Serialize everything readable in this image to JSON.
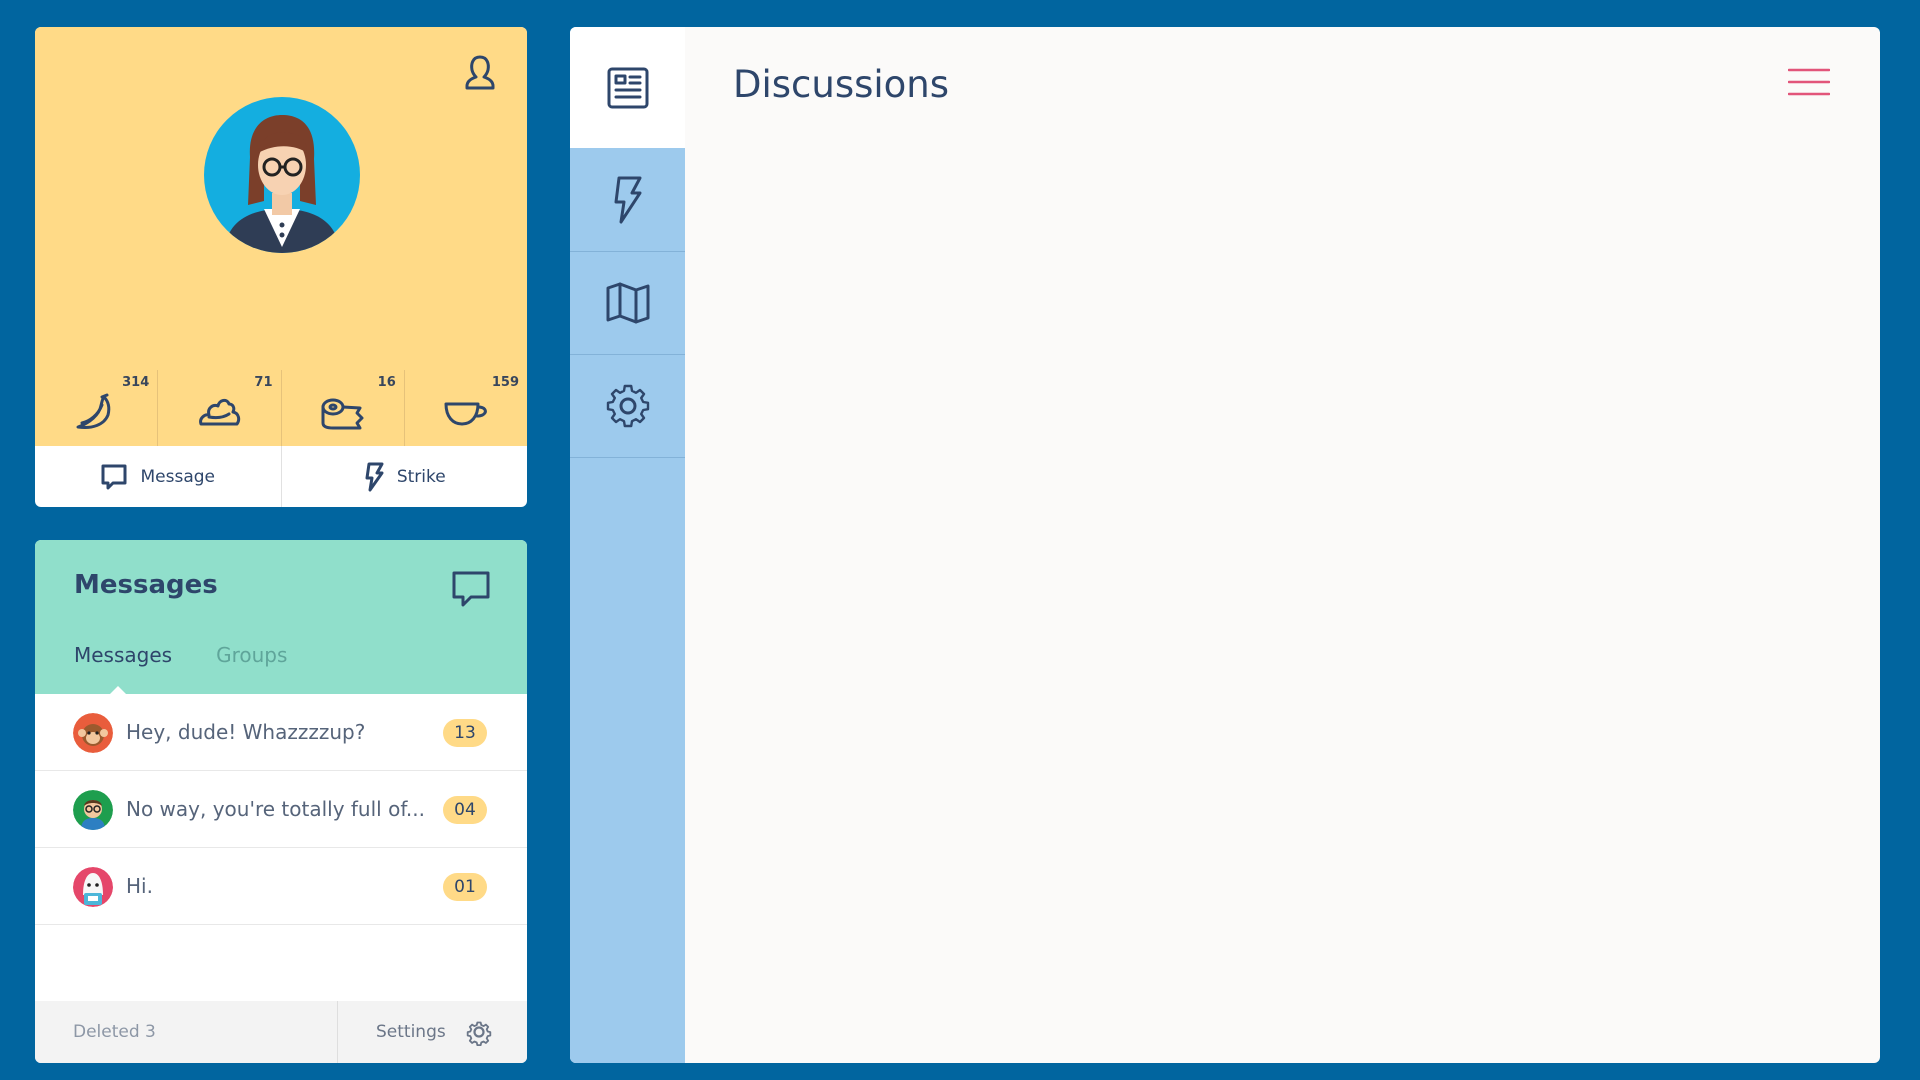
{
  "profile": {
    "stats": [
      {
        "icon": "banana-icon",
        "count": "314"
      },
      {
        "icon": "whipped-cream-icon",
        "count": "71"
      },
      {
        "icon": "toilet-paper-icon",
        "count": "16"
      },
      {
        "icon": "cup-icon",
        "count": "159"
      }
    ],
    "actions": {
      "message_label": "Message",
      "strike_label": "Strike"
    }
  },
  "messages": {
    "title": "Messages",
    "tabs": [
      {
        "label": "Messages",
        "active": true
      },
      {
        "label": "Groups",
        "active": false
      }
    ],
    "items": [
      {
        "text": "Hey, dude! Whazzzzup?",
        "badge": "13"
      },
      {
        "text": "No way, you're totally full of...",
        "badge": "04"
      },
      {
        "text": "Hi.",
        "badge": "01"
      }
    ],
    "footer": {
      "deleted_label": "Deleted 3",
      "settings_label": "Settings"
    }
  },
  "main": {
    "title": "Discussions",
    "nav": [
      {
        "icon": "news-icon",
        "active": true
      },
      {
        "icon": "lightning-icon",
        "active": false
      },
      {
        "icon": "map-icon",
        "active": false
      },
      {
        "icon": "gear-icon",
        "active": false
      }
    ]
  },
  "colors": {
    "background": "#01659f",
    "profile_header": "#ffda87",
    "messages_header": "#90dfcb",
    "side_nav": "#9dcaed",
    "text_dark": "#2e466b",
    "menu_accent": "#e2557a"
  }
}
